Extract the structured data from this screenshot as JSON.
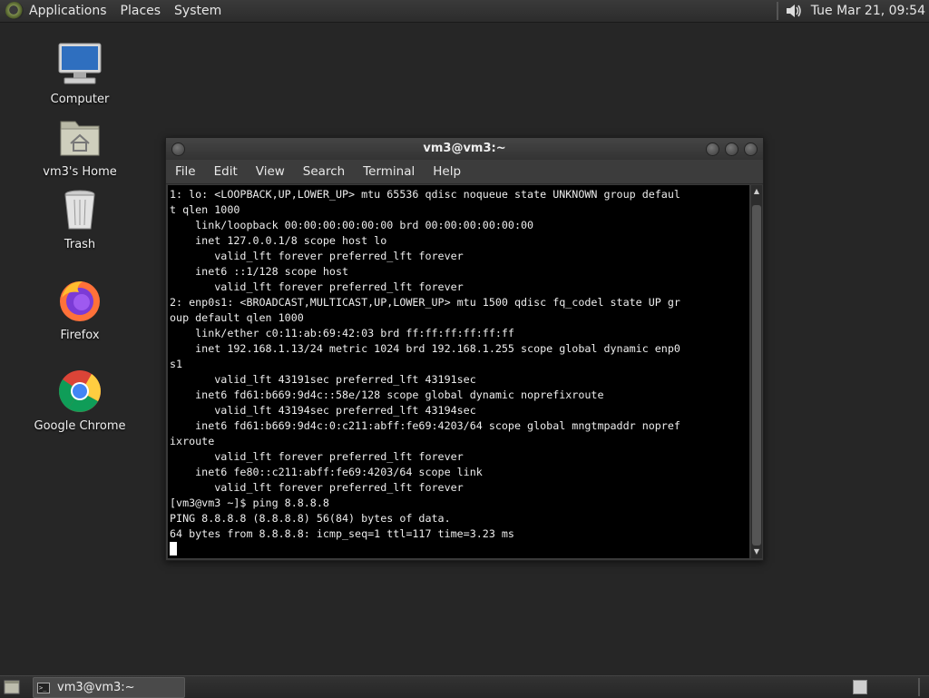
{
  "top_panel": {
    "menus": [
      "Applications",
      "Places",
      "System"
    ],
    "clock": "Tue Mar 21, 09:54",
    "icons": [
      "distro-logo-icon",
      "volume-icon"
    ]
  },
  "desktop": {
    "icons": [
      {
        "label": "Computer",
        "icon": "computer-icon"
      },
      {
        "label": "vm3's Home",
        "icon": "home-folder-icon"
      },
      {
        "label": "Trash",
        "icon": "trash-icon"
      },
      {
        "label": "Firefox",
        "icon": "firefox-icon"
      },
      {
        "label": "Google Chrome",
        "icon": "chrome-icon"
      }
    ]
  },
  "terminal": {
    "title": "vm3@vm3:~",
    "menu": [
      "File",
      "Edit",
      "View",
      "Search",
      "Terminal",
      "Help"
    ],
    "lines": [
      "1: lo: <LOOPBACK,UP,LOWER_UP> mtu 65536 qdisc noqueue state UNKNOWN group defaul",
      "t qlen 1000",
      "    link/loopback 00:00:00:00:00:00 brd 00:00:00:00:00:00",
      "    inet 127.0.0.1/8 scope host lo",
      "       valid_lft forever preferred_lft forever",
      "    inet6 ::1/128 scope host",
      "       valid_lft forever preferred_lft forever",
      "2: enp0s1: <BROADCAST,MULTICAST,UP,LOWER_UP> mtu 1500 qdisc fq_codel state UP gr",
      "oup default qlen 1000",
      "    link/ether c0:11:ab:69:42:03 brd ff:ff:ff:ff:ff:ff",
      "    inet 192.168.1.13/24 metric 1024 brd 192.168.1.255 scope global dynamic enp0",
      "s1",
      "       valid_lft 43191sec preferred_lft 43191sec",
      "    inet6 fd61:b669:9d4c::58e/128 scope global dynamic noprefixroute",
      "       valid_lft 43194sec preferred_lft 43194sec",
      "    inet6 fd61:b669:9d4c:0:c211:abff:fe69:4203/64 scope global mngtmpaddr nopref",
      "ixroute",
      "       valid_lft forever preferred_lft forever",
      "    inet6 fe80::c211:abff:fe69:4203/64 scope link",
      "       valid_lft forever preferred_lft forever",
      "[vm3@vm3 ~]$ ping 8.8.8.8",
      "PING 8.8.8.8 (8.8.8.8) 56(84) bytes of data.",
      "64 bytes from 8.8.8.8: icmp_seq=1 ttl=117 time=3.23 ms"
    ]
  },
  "taskbar": {
    "window_button": "vm3@vm3:~"
  }
}
